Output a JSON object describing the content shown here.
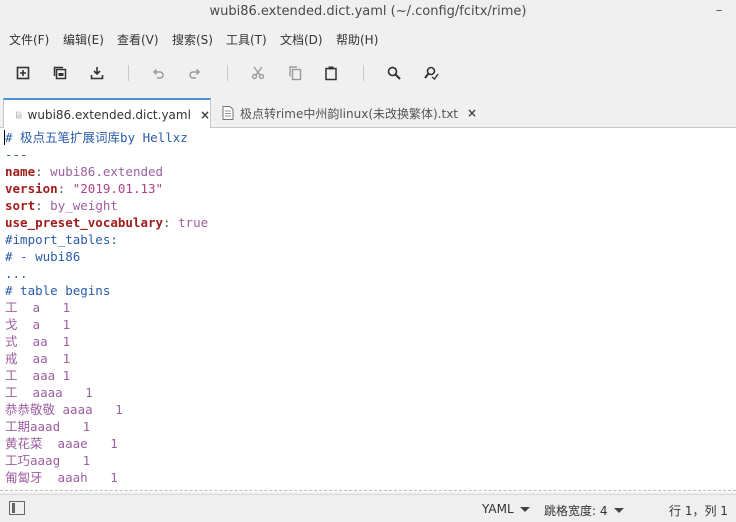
{
  "window": {
    "title": "wubi86.extended.dict.yaml (~/.config/fcitx/rime)",
    "minimize_glyph": "–"
  },
  "menu": [
    "文件(F)",
    "编辑(E)",
    "查看(V)",
    "搜索(S)",
    "工具(T)",
    "文档(D)",
    "帮助(H)"
  ],
  "toolbar_icons": [
    "new-file-icon",
    "open-file-icon",
    "save-file-icon",
    "undo-icon",
    "redo-icon",
    "cut-icon",
    "copy-icon",
    "paste-icon",
    "search-icon",
    "replace-icon"
  ],
  "tabs": [
    {
      "label": "wubi86.extended.dict.yaml",
      "active": true,
      "close": "×"
    },
    {
      "label": "极点转rime中州韵linux(未改换繁体).txt",
      "active": false,
      "close": "×"
    }
  ],
  "editor": {
    "comment_title": "# 极点五笔扩展词库by Hellxz",
    "doc_start": "---",
    "fields": [
      {
        "key": "name",
        "sep": ": ",
        "value": "wubi86.extended",
        "kind": "val"
      },
      {
        "key": "version",
        "sep": ": ",
        "value": "\"2019.01.13\"",
        "kind": "str"
      },
      {
        "key": "sort",
        "sep": ": ",
        "value": "by_weight",
        "kind": "val"
      },
      {
        "key": "use_preset_vocabulary",
        "sep": ": ",
        "value": "true",
        "kind": "bool"
      }
    ],
    "import_comment": "#import_tables:",
    "import_item": "# - wubi86",
    "doc_end": "...",
    "table_comment": "# table begins",
    "table_rows": [
      "工  a   1",
      "戈  a   1",
      "式  aa  1",
      "戒  aa  1",
      "工  aaa 1",
      "工  aaaa   1",
      "恭恭敬敬 aaaa   1",
      "工期aaad   1",
      "黄花菜  aaae   1",
      "工巧aaag   1",
      "匍匐牙  aaah   1"
    ]
  },
  "status": {
    "language": "YAML",
    "tab_width": "跳格宽度: 4",
    "position": "行 1，列 1"
  }
}
